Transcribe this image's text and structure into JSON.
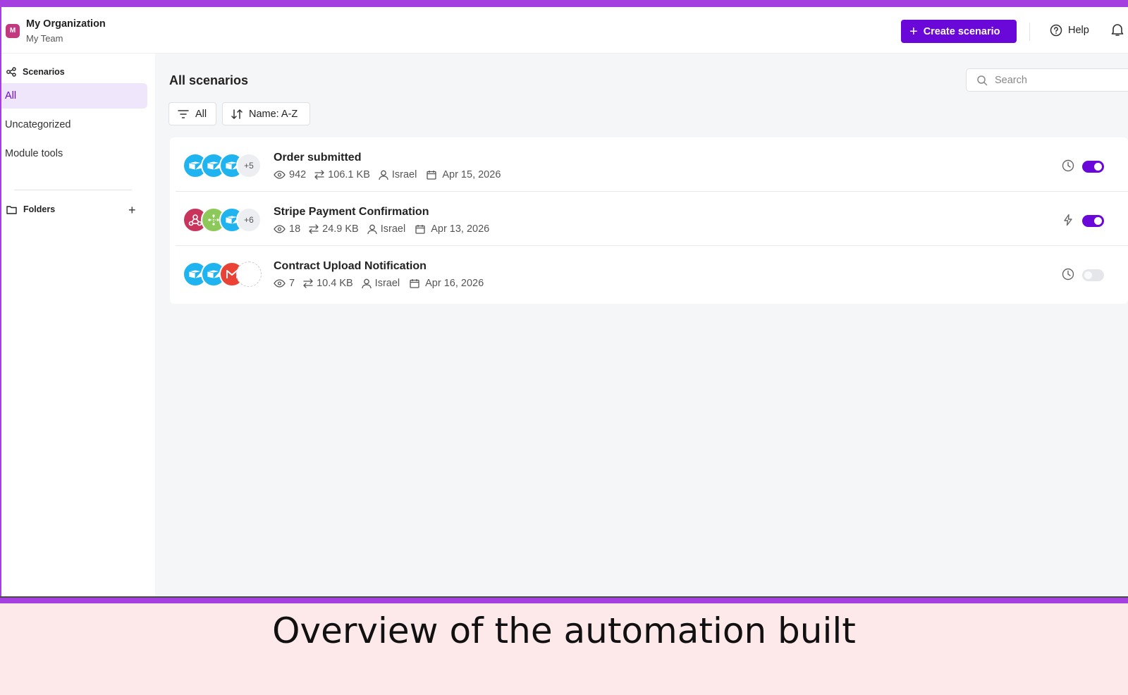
{
  "header": {
    "org_initial": "M",
    "org_name": "My Organization",
    "team_name": "My Team",
    "create_label": "Create scenario",
    "help_label": "Help"
  },
  "sidebar": {
    "section_label": "Scenarios",
    "items": [
      {
        "label": "All",
        "active": true
      },
      {
        "label": "Uncategorized",
        "active": false
      },
      {
        "label": "Module tools",
        "active": false
      }
    ],
    "folders_label": "Folders"
  },
  "main": {
    "title": "All scenarios",
    "search_placeholder": "Search",
    "filter_label": "All",
    "sort_label": "Name: A-Z"
  },
  "scenarios": [
    {
      "name": "Order submitted",
      "operations": "942",
      "data": "106.1 KB",
      "owner": "Israel",
      "date": "Apr 15, 2026",
      "more_modules": "+5",
      "schedule": "clock-icon",
      "enabled": true
    },
    {
      "name": "Stripe Payment Confirmation",
      "operations": "18",
      "data": "24.9 KB",
      "owner": "Israel",
      "date": "Apr 13, 2026",
      "more_modules": "+6",
      "schedule": "lightning-icon",
      "enabled": true
    },
    {
      "name": "Contract Upload Notification",
      "operations": "7",
      "data": "10.4 KB",
      "owner": "Israel",
      "date": "Apr 16, 2026",
      "more_modules": "",
      "schedule": "clock-icon",
      "enabled": false
    }
  ],
  "caption": "Overview of the automation built",
  "colors": {
    "accent": "#6a08d9",
    "frame": "#a63fe0",
    "caption_bg": "#fde8ea"
  }
}
